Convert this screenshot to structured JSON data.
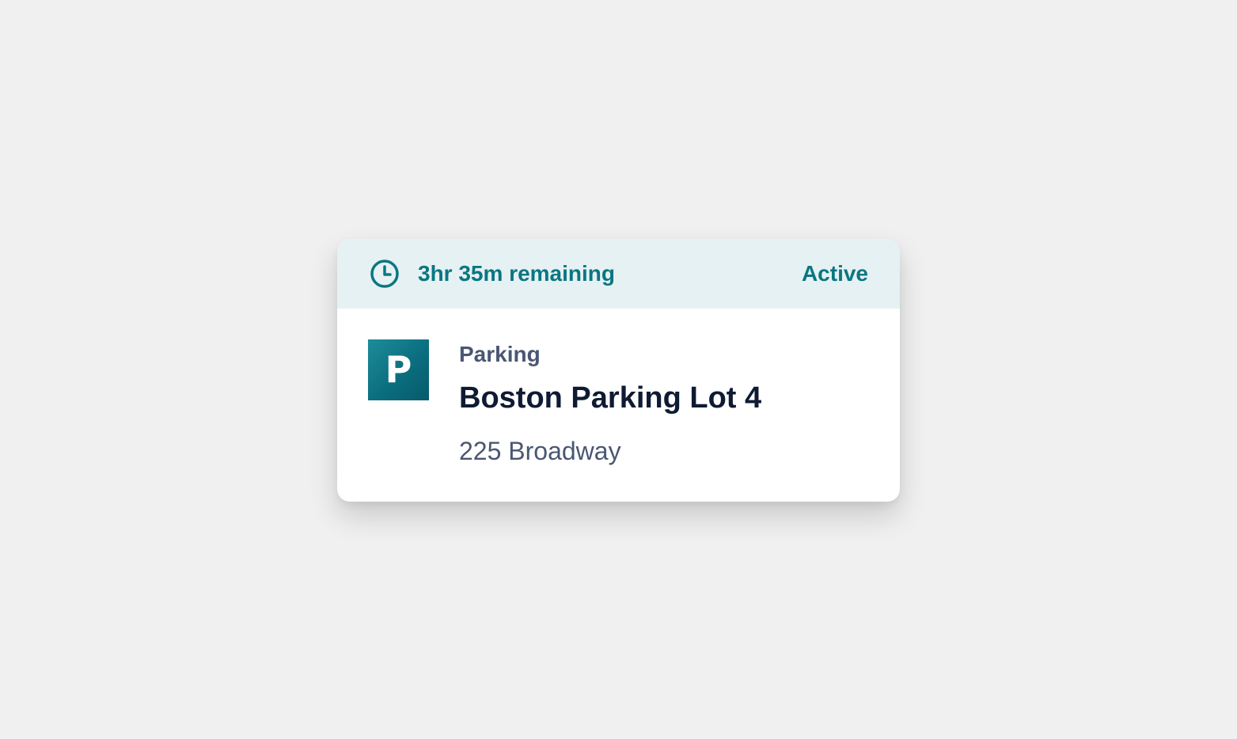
{
  "session": {
    "time_remaining": "3hr 35m remaining",
    "status": "Active",
    "clock_icon": "clock-icon"
  },
  "location": {
    "icon": "parking-icon",
    "icon_letter": "P",
    "category": "Parking",
    "name": "Boston Parking Lot 4",
    "address": "225 Broadway"
  },
  "colors": {
    "background": "#f0f0f0",
    "card": "#ffffff",
    "header": "#e5f1f2",
    "accent": "#0a7682",
    "title": "#0f1a33",
    "muted": "#495773"
  }
}
